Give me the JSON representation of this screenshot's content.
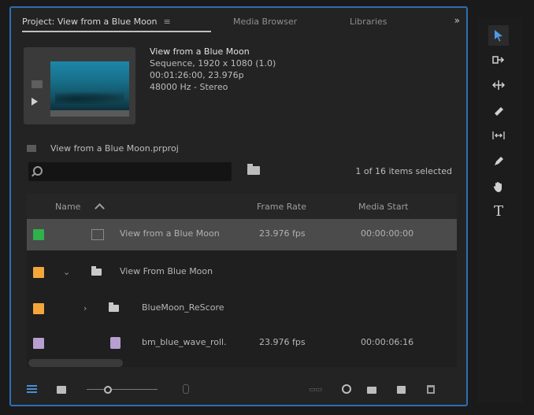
{
  "tabs": {
    "project": "Project: View from a Blue Moon",
    "media_browser": "Media Browser",
    "libraries": "Libraries",
    "more": "»"
  },
  "clip": {
    "title": "View from a Blue Moon",
    "line1": "Sequence, 1920 x 1080 (1.0)",
    "line2": "00:01:26:00, 23.976p",
    "line3": "48000 Hz - Stereo"
  },
  "project_file": "View from a Blue Moon.prproj",
  "search": {
    "placeholder": ""
  },
  "selection_count": "1 of 16 items selected",
  "columns": {
    "name": "Name",
    "frame_rate": "Frame Rate",
    "media_start": "Media Start"
  },
  "rows": [
    {
      "name": "View from a Blue Moon",
      "frame_rate": "23.976 fps",
      "media_start": "00:00:00:00",
      "color": "#2fb14b",
      "selected": true
    },
    {
      "name": "View From Blue Moon",
      "frame_rate": "",
      "media_start": "",
      "color": "#f3a63a",
      "expanded": true
    },
    {
      "name": "BlueMoon_ReScore",
      "frame_rate": "",
      "media_start": "",
      "color": "#f3a63a",
      "expanded": false
    },
    {
      "name": "bm_blue_wave_roll.",
      "frame_rate": "23.976 fps",
      "media_start": "00:00:06:16",
      "color": "#b79fd1"
    }
  ],
  "tool_icons": [
    "selection-tool-icon",
    "track-select-icon",
    "ripple-edit-icon",
    "razor-icon",
    "slip-icon",
    "pen-icon",
    "hand-icon",
    "type-icon"
  ],
  "tool_glyphs": {
    "type": "T"
  },
  "accent": "#2d6fb3"
}
